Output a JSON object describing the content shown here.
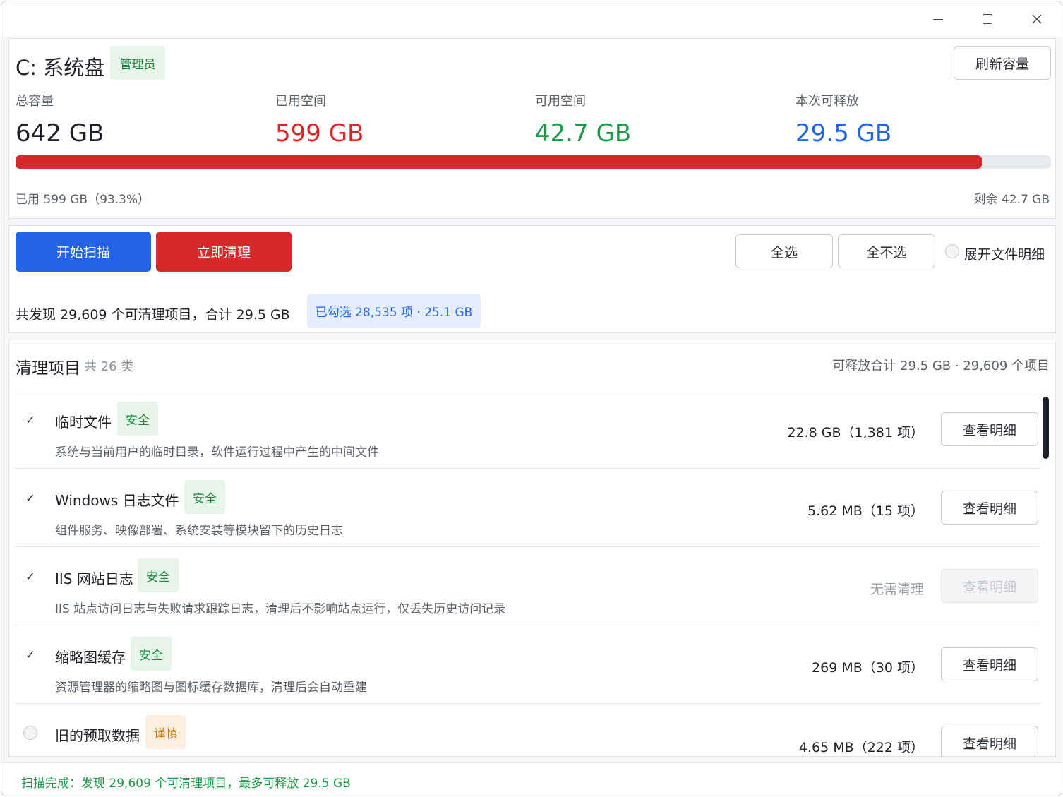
{
  "window": {
    "controls": {
      "minimize": "minimize",
      "maximize": "maximize",
      "close": "close"
    }
  },
  "disk": {
    "title": "C: 系统盘",
    "badge": "管理员",
    "refresh_label": "刷新容量",
    "stats": [
      {
        "label": "总容量",
        "value": "642 GB",
        "color": "#1f2329"
      },
      {
        "label": "已用空间",
        "value": "599 GB",
        "color": "#d7282b"
      },
      {
        "label": "可用空间",
        "value": "42.7 GB",
        "color": "#1c9a4a"
      },
      {
        "label": "本次可释放",
        "value": "29.5 GB",
        "color": "#2463e8"
      }
    ],
    "usage_percent": 93.3,
    "usage_left": "已用 599 GB（93.3%）",
    "usage_right": "剩余 42.7 GB"
  },
  "actions": {
    "scan_label": "开始扫描",
    "clean_label": "立即清理",
    "select_all_label": "全选",
    "select_none_label": "全不选",
    "expand_label": "展开文件明细",
    "expand_checked": false,
    "summary": "共发现 29,609 个可清理项目，合计 29.5 GB",
    "selected_badge": "已勾选 28,535 项 · 25.1 GB"
  },
  "list": {
    "title": "清理项目",
    "count": "共 26 类",
    "total": "可释放合计 29.5 GB · 29,609 个项目",
    "detail_label": "查看明细",
    "items": [
      {
        "checked": true,
        "name": "临时文件",
        "tag": "安全",
        "tag_type": "safe",
        "desc": "系统与当前用户的临时目录，软件运行过程中产生的中间文件",
        "size": "22.8 GB（1,381 项）",
        "enabled": true
      },
      {
        "checked": true,
        "name": "Windows 日志文件",
        "tag": "安全",
        "tag_type": "safe",
        "desc": "组件服务、映像部署、系统安装等模块留下的历史日志",
        "size": "5.62 MB（15 项）",
        "enabled": true
      },
      {
        "checked": true,
        "name": "IIS 网站日志",
        "tag": "安全",
        "tag_type": "safe",
        "desc": "IIS 站点访问日志与失败请求跟踪日志，清理后不影响站点运行，仅丢失历史访问记录",
        "size": "无需清理",
        "enabled": false
      },
      {
        "checked": true,
        "name": "缩略图缓存",
        "tag": "安全",
        "tag_type": "safe",
        "desc": "资源管理器的缩略图与图标缓存数据库，清理后会自动重建",
        "size": "269 MB（30 项）",
        "enabled": true
      },
      {
        "checked": false,
        "name": "旧的预取数据",
        "tag": "谨慎",
        "tag_type": "warn",
        "desc": "",
        "size": "4.65 MB（222 项）",
        "enabled": true
      }
    ]
  },
  "status": {
    "text": "扫描完成：发现 29,609 个可清理项目，最多可释放 29.5 GB"
  }
}
